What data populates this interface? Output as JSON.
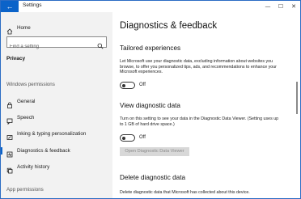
{
  "window": {
    "title": "Settings",
    "back_glyph": "←",
    "minimize_glyph": "—",
    "maximize_glyph": "☐",
    "close_glyph": "✕"
  },
  "sidebar": {
    "home_label": "Home",
    "search_placeholder": "Find a setting",
    "privacy_label": "Privacy",
    "windows_permissions_header": "Windows permissions",
    "items": [
      {
        "label": "General",
        "icon": "lock-icon"
      },
      {
        "label": "Speech",
        "icon": "speech-icon"
      },
      {
        "label": "Inking & typing personalization",
        "icon": "pen-icon"
      },
      {
        "label": "Diagnostics & feedback",
        "icon": "diagnostics-icon",
        "selected": true
      },
      {
        "label": "Activity history",
        "icon": "history-icon"
      }
    ],
    "app_permissions_header": "App permissions"
  },
  "main": {
    "page_title": "Diagnostics & feedback",
    "tailored": {
      "heading": "Tailored experiences",
      "description": "Let Microsoft use your diagnostic data, excluding information about websites you browse, to offer you personalized tips, ads, and recommendations to enhance your Microsoft experiences.",
      "toggle_label": "Off",
      "toggle_on": false
    },
    "view_diag": {
      "heading": "View diagnostic data",
      "description": "Turn on this setting to see your data in the Diagnostic Data Viewer. (Setting uses up to 1 GB of hard drive space.)",
      "toggle_label": "Off",
      "toggle_on": false,
      "button_label": "Open Diagnostic Data Viewer"
    },
    "delete_diag": {
      "heading": "Delete diagnostic data",
      "description": "Delete diagnostic data that Microsoft has collected about this device."
    }
  },
  "colors": {
    "accent": "#0b63c9",
    "sidebar_bg": "#f2f2f2"
  }
}
